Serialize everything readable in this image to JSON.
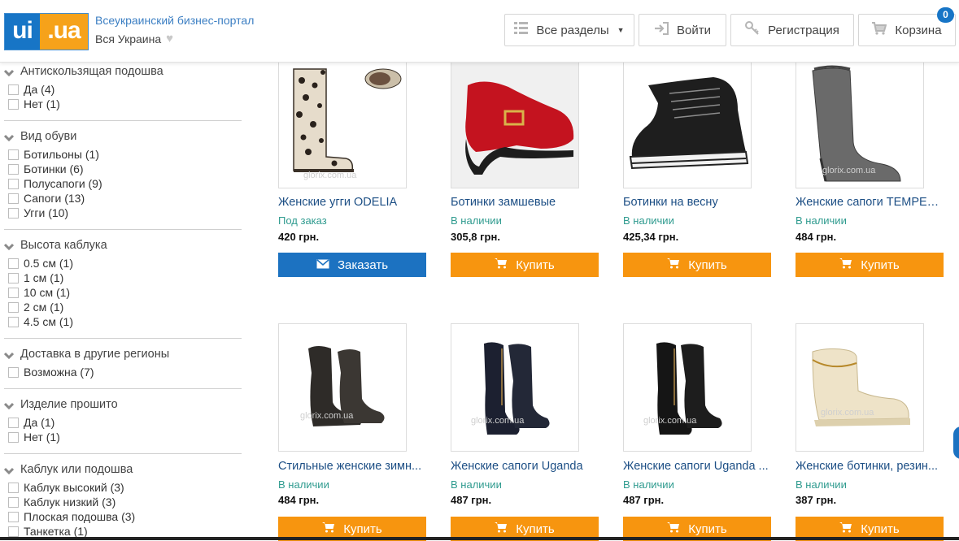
{
  "header": {
    "logo_left": "ui",
    "logo_right": ".ua",
    "tagline": "Всеукраинский бизнес-портал",
    "region": "Вся Украина",
    "buttons": {
      "all_sections": "Все разделы",
      "login": "Войти",
      "register": "Регистрация",
      "cart": "Корзина"
    },
    "cart_count": "0"
  },
  "filters": [
    {
      "title": "Антискользящая подошва",
      "options": [
        "Да (4)",
        "Нет (1)"
      ]
    },
    {
      "title": "Вид обуви",
      "options": [
        "Ботильоны (1)",
        "Ботинки (6)",
        "Полусапоги (9)",
        "Сапоги (13)",
        "Угги (10)"
      ]
    },
    {
      "title": "Высота каблука",
      "options": [
        "0.5 см (1)",
        "1 см (1)",
        "10 см (1)",
        "2 см (1)",
        "4.5 см (1)"
      ]
    },
    {
      "title": "Доставка в другие регионы",
      "options": [
        "Возможна (7)"
      ]
    },
    {
      "title": "Изделие прошито",
      "options": [
        "Да (1)",
        "Нет (1)"
      ]
    },
    {
      "title": "Каблук или подошва",
      "options": [
        "Каблук высокий (3)",
        "Каблук низкий (3)",
        "Плоская подошва (3)",
        "Танкетка (1)"
      ]
    }
  ],
  "products": [
    {
      "title": "Женские угги ODELIA",
      "status": "Под заказ",
      "price": "420 грн.",
      "button": "Заказать",
      "kind": "order",
      "watermark": "glorix.com.ua"
    },
    {
      "title": "Ботинки замшевые",
      "status": "В наличии",
      "price": "305,8 грн.",
      "button": "Купить",
      "kind": "buy",
      "watermark": ""
    },
    {
      "title": "Ботинки на весну",
      "status": "В наличии",
      "price": "425,34 грн.",
      "button": "Купить",
      "kind": "buy",
      "watermark": ""
    },
    {
      "title": "Женские сапоги TEMPER...",
      "status": "В наличии",
      "price": "484 грн.",
      "button": "Купить",
      "kind": "buy",
      "watermark": "glorix.com.ua"
    },
    {
      "title": "Стильные женские зимн...",
      "status": "В наличии",
      "price": "484 грн.",
      "button": "Купить",
      "kind": "buy",
      "watermark": "glorix.com.ua"
    },
    {
      "title": "Женские сапоги Uganda",
      "status": "В наличии",
      "price": "487 грн.",
      "button": "Купить",
      "kind": "buy",
      "watermark": "glorix.com.ua"
    },
    {
      "title": "Женские сапоги Uganda ...",
      "status": "В наличии",
      "price": "487 грн.",
      "button": "Купить",
      "kind": "buy",
      "watermark": "glorix.com.ua"
    },
    {
      "title": "Женские ботинки, резин...",
      "status": "В наличии",
      "price": "387 грн.",
      "button": "Купить",
      "kind": "buy",
      "watermark": "glorix.com.ua"
    }
  ],
  "colors": {
    "brand_blue": "#1775c6",
    "brand_orange": "#f6a21a",
    "buy_button": "#f7950f",
    "order_button": "#1c72c1",
    "status_text": "#2f9b8f",
    "title_link": "#1d4f85"
  }
}
